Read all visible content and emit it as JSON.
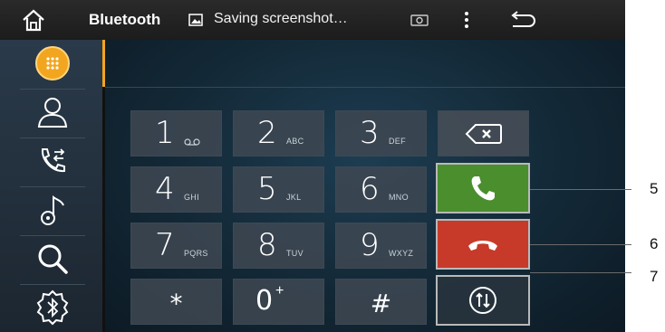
{
  "statusbar": {
    "home_icon": "home-icon",
    "title": "Bluetooth",
    "notification_icon": "image-icon",
    "notification": "Saving screenshot…",
    "right_icons": [
      "camera-icon",
      "menu-icon",
      "back-icon"
    ]
  },
  "sidebar": {
    "items": [
      {
        "name": "dialpad",
        "icon": "dialpad-icon",
        "active": true
      },
      {
        "name": "contacts",
        "icon": "contact-icon"
      },
      {
        "name": "call-log",
        "icon": "call-log-icon"
      },
      {
        "name": "music",
        "icon": "music-icon"
      },
      {
        "name": "search",
        "icon": "search-icon"
      },
      {
        "name": "bluetooth-settings",
        "icon": "bluetooth-settings-icon"
      }
    ]
  },
  "keypad": {
    "keys": [
      {
        "digit": "1",
        "letters": ""
      },
      {
        "digit": "2",
        "letters": "ABC"
      },
      {
        "digit": "3",
        "letters": "DEF"
      },
      {
        "digit": "4",
        "letters": "GHI"
      },
      {
        "digit": "5",
        "letters": "JKL"
      },
      {
        "digit": "6",
        "letters": "MNO"
      },
      {
        "digit": "7",
        "letters": "PQRS"
      },
      {
        "digit": "8",
        "letters": "TUV"
      },
      {
        "digit": "9",
        "letters": "WXYZ"
      }
    ],
    "star": "*",
    "zero": "0",
    "zero_sub": "+",
    "hash": "#"
  },
  "actions": {
    "backspace_icon": "backspace-icon",
    "call_icon": "phone-icon",
    "hangup_icon": "hangup-icon",
    "swap_icon": "transfer-icon",
    "call_color": "#4a8e2d",
    "hangup_color": "#c73a2a"
  },
  "callouts": [
    "5",
    "6",
    "7"
  ]
}
